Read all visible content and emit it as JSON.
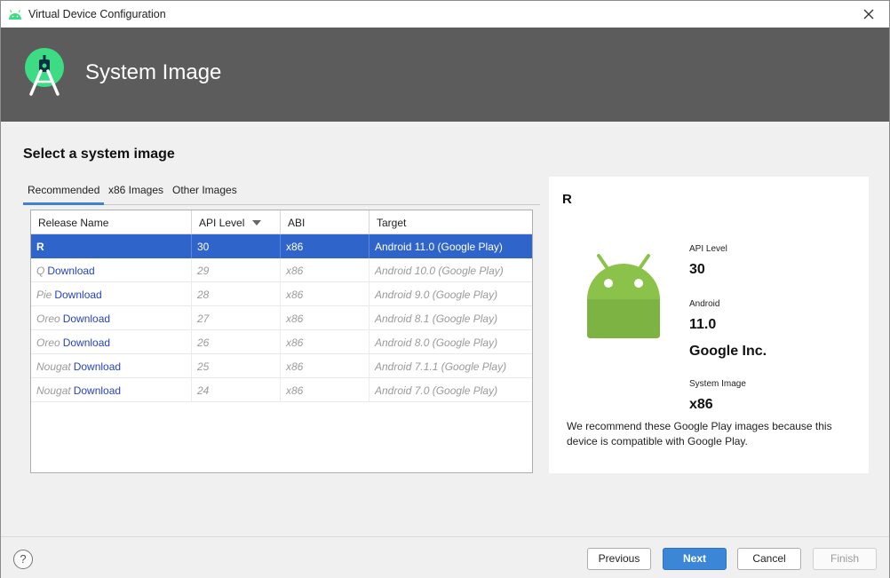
{
  "window": {
    "title": "Virtual Device Configuration",
    "close_glyph": "✕"
  },
  "banner": {
    "title": "System Image",
    "logo_icon": "android-studio-logo-icon",
    "background": "#5c5c5c"
  },
  "section_title": "Select a system image",
  "tabs": [
    {
      "label": "Recommended",
      "active": true
    },
    {
      "label": "x86 Images",
      "active": false
    },
    {
      "label": "Other Images",
      "active": false
    }
  ],
  "table": {
    "columns": [
      "Release Name",
      "API Level",
      "ABI",
      "Target"
    ],
    "sort_column": "API Level",
    "rows": [
      {
        "name": "R",
        "download": "",
        "api": "30",
        "abi": "x86",
        "target": "Android 11.0 (Google Play)",
        "selected": true
      },
      {
        "name": "Q",
        "download": "Download",
        "api": "29",
        "abi": "x86",
        "target": "Android 10.0 (Google Play)",
        "selected": false
      },
      {
        "name": "Pie",
        "download": "Download",
        "api": "28",
        "abi": "x86",
        "target": "Android 9.0 (Google Play)",
        "selected": false
      },
      {
        "name": "Oreo",
        "download": "Download",
        "api": "27",
        "abi": "x86",
        "target": "Android 8.1 (Google Play)",
        "selected": false
      },
      {
        "name": "Oreo",
        "download": "Download",
        "api": "26",
        "abi": "x86",
        "target": "Android 8.0 (Google Play)",
        "selected": false
      },
      {
        "name": "Nougat",
        "download": "Download",
        "api": "25",
        "abi": "x86",
        "target": "Android 7.1.1 (Google Play)",
        "selected": false
      },
      {
        "name": "Nougat",
        "download": "Download",
        "api": "24",
        "abi": "x86",
        "target": "Android 7.0 (Google Play)",
        "selected": false
      }
    ]
  },
  "detail": {
    "title": "R",
    "api_level_label": "API Level",
    "api_level": "30",
    "android_label": "Android",
    "android_version": "11.0",
    "vendor": "Google Inc.",
    "system_image_label": "System Image",
    "system_image": "x86",
    "description": "We recommend these Google Play images because this device is compatible with Google Play.",
    "robot_color": "#8bc34a"
  },
  "footer": {
    "help_label": "?",
    "previous": "Previous",
    "next": "Next",
    "cancel": "Cancel",
    "finish": "Finish"
  },
  "colors": {
    "selection": "#2f65ca",
    "link": "#2743c2",
    "primary_button": "#3b86d6"
  }
}
